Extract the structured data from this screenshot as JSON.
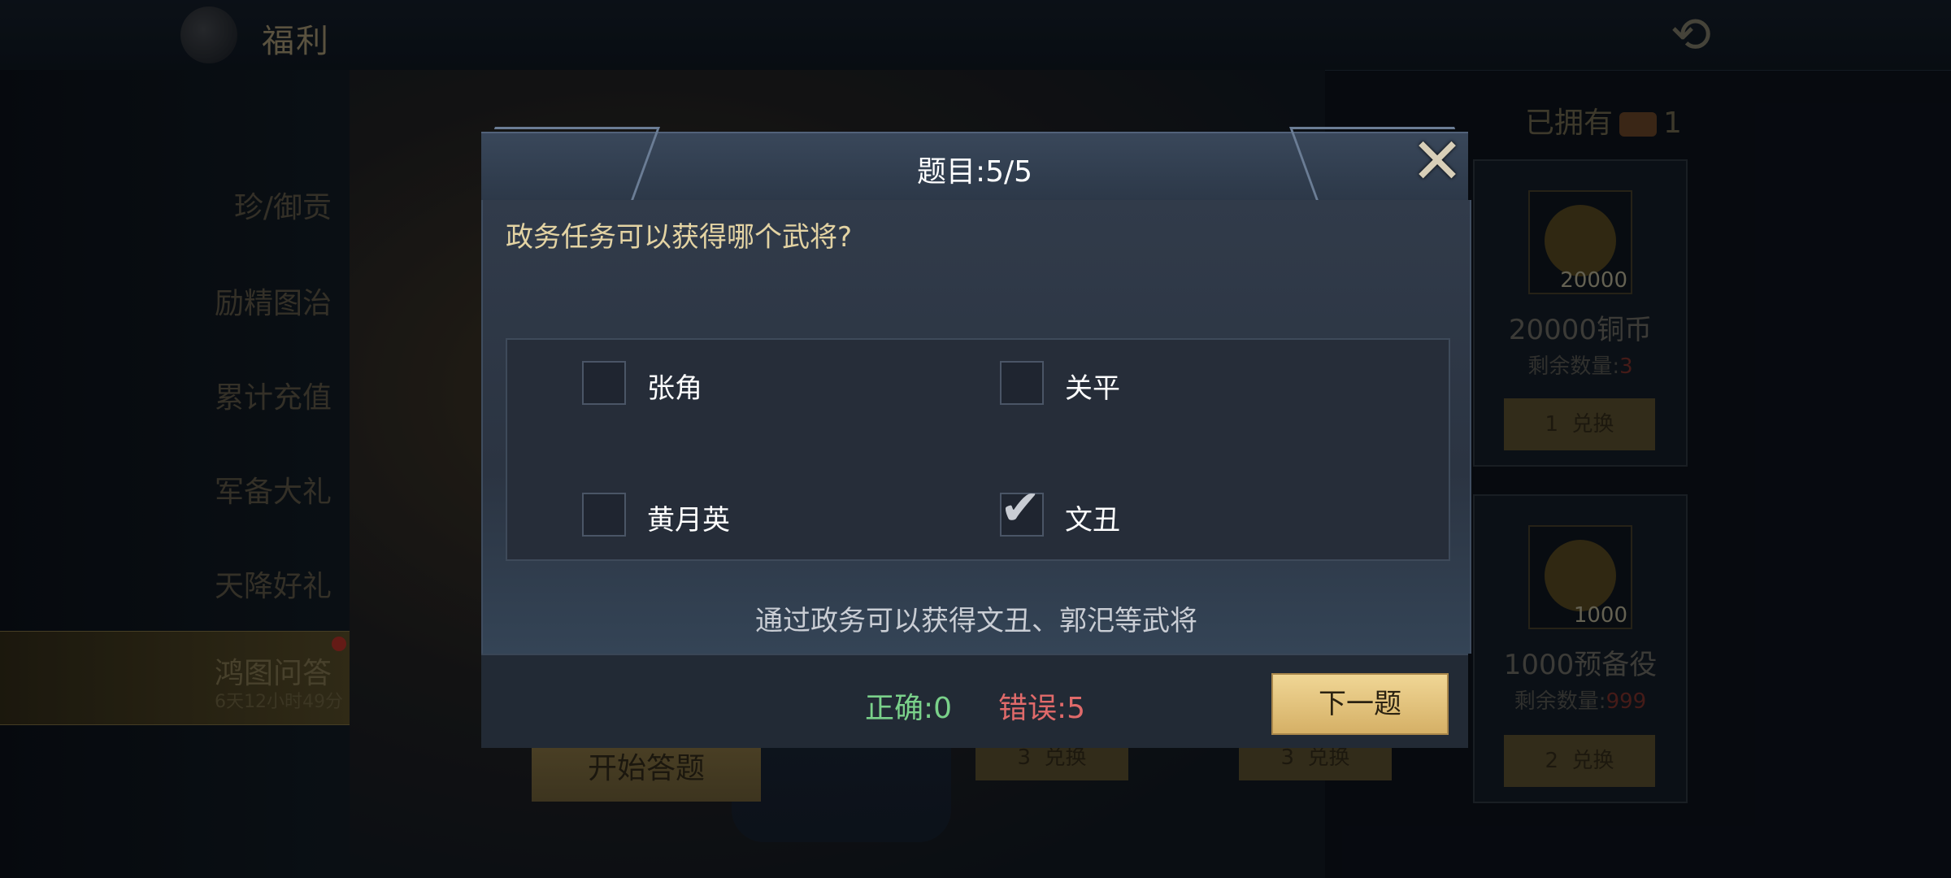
{
  "header": {
    "title": "福利"
  },
  "sidebar": {
    "items": [
      {
        "label": "珍/御贡"
      },
      {
        "label": "励精图治"
      },
      {
        "label": "累计充值"
      },
      {
        "label": "军备大礼"
      },
      {
        "label": "天降好礼"
      },
      {
        "label": "鸿图问答",
        "timer": "6天12小时49分",
        "active": true
      }
    ]
  },
  "start_button": "开始答题",
  "owned": {
    "label": "已拥有",
    "count": "1"
  },
  "rewards": [
    {
      "amount": "20000",
      "name": "20000铜币",
      "remain_label": "剩余数量:",
      "remain": "3",
      "cost": "1",
      "exchange": "兑换"
    },
    {
      "amount": "1000",
      "name": "1000预备役",
      "remain_label": "剩余数量:",
      "remain": "999",
      "cost": "2",
      "exchange": "兑换"
    }
  ],
  "bottom_exchanges": [
    {
      "cost": "3",
      "exchange": "兑换"
    },
    {
      "cost": "3",
      "exchange": "兑换"
    }
  ],
  "dialog": {
    "question_number": "题目:5/5",
    "question": "政务任务可以获得哪个武将?",
    "options": [
      {
        "label": "张角",
        "checked": false
      },
      {
        "label": "关平",
        "checked": false
      },
      {
        "label": "黄月英",
        "checked": false
      },
      {
        "label": "文丑",
        "checked": true
      }
    ],
    "explanation": "通过政务可以获得文丑、郭汜等武将",
    "correct": "正确:0",
    "wrong": "错误:5",
    "next_button": "下一题"
  },
  "colors": {
    "correct": "#7ad18a",
    "wrong": "#e06a6a",
    "question_text": "#e3d3a3",
    "next_button": "#e7c67e"
  },
  "icons": [
    "close-icon",
    "check-icon",
    "dragon-logo-icon",
    "coin-icon",
    "helmet-icon",
    "token-icon"
  ]
}
